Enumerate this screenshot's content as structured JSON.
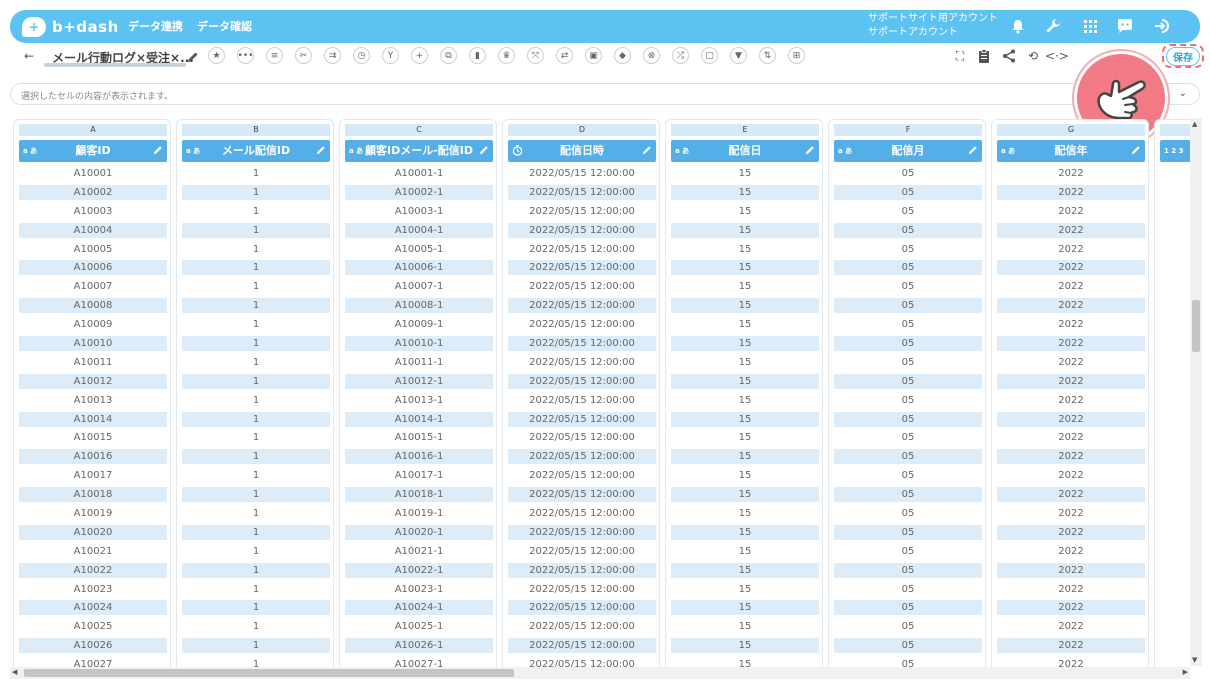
{
  "app": {
    "logo_text": "b+dash"
  },
  "nav": [
    {
      "label": "データ連携"
    },
    {
      "label": "データ確認"
    }
  ],
  "account": {
    "line1": "サポートサイト用アカウント",
    "line2": "サポートアカウント"
  },
  "toolbar": {
    "title": "メール行動ログ×受注×...",
    "save_label": "保存"
  },
  "cellbar": {
    "placeholder": "選択したセルの内容が表示されます。"
  },
  "columns": [
    {
      "letter": "A",
      "name": "顧客ID",
      "type": "a あ"
    },
    {
      "letter": "B",
      "name": "メール配信ID",
      "type": "a あ"
    },
    {
      "letter": "C",
      "name": "顧客IDメール-配信ID",
      "type": "a あ"
    },
    {
      "letter": "D",
      "name": "配信日時",
      "type": "clock"
    },
    {
      "letter": "E",
      "name": "配信日",
      "type": "a あ"
    },
    {
      "letter": "F",
      "name": "配信月",
      "type": "a あ"
    },
    {
      "letter": "G",
      "name": "配信年",
      "type": "a あ"
    },
    {
      "letter": "",
      "name": "",
      "type": "1 2 3"
    }
  ],
  "rows": [
    [
      "A10001",
      "1",
      "A10001-1",
      "2022/05/15 12:00:00",
      "15",
      "05",
      "2022"
    ],
    [
      "A10002",
      "1",
      "A10002-1",
      "2022/05/15 12:00:00",
      "15",
      "05",
      "2022"
    ],
    [
      "A10003",
      "1",
      "A10003-1",
      "2022/05/15 12:00:00",
      "15",
      "05",
      "2022"
    ],
    [
      "A10004",
      "1",
      "A10004-1",
      "2022/05/15 12:00:00",
      "15",
      "05",
      "2022"
    ],
    [
      "A10005",
      "1",
      "A10005-1",
      "2022/05/15 12:00:00",
      "15",
      "05",
      "2022"
    ],
    [
      "A10006",
      "1",
      "A10006-1",
      "2022/05/15 12:00:00",
      "15",
      "05",
      "2022"
    ],
    [
      "A10007",
      "1",
      "A10007-1",
      "2022/05/15 12:00:00",
      "15",
      "05",
      "2022"
    ],
    [
      "A10008",
      "1",
      "A10008-1",
      "2022/05/15 12:00:00",
      "15",
      "05",
      "2022"
    ],
    [
      "A10009",
      "1",
      "A10009-1",
      "2022/05/15 12:00:00",
      "15",
      "05",
      "2022"
    ],
    [
      "A10010",
      "1",
      "A10010-1",
      "2022/05/15 12:00:00",
      "15",
      "05",
      "2022"
    ],
    [
      "A10011",
      "1",
      "A10011-1",
      "2022/05/15 12:00:00",
      "15",
      "05",
      "2022"
    ],
    [
      "A10012",
      "1",
      "A10012-1",
      "2022/05/15 12:00:00",
      "15",
      "05",
      "2022"
    ],
    [
      "A10013",
      "1",
      "A10013-1",
      "2022/05/15 12:00:00",
      "15",
      "05",
      "2022"
    ],
    [
      "A10014",
      "1",
      "A10014-1",
      "2022/05/15 12:00:00",
      "15",
      "05",
      "2022"
    ],
    [
      "A10015",
      "1",
      "A10015-1",
      "2022/05/15 12:00:00",
      "15",
      "05",
      "2022"
    ],
    [
      "A10016",
      "1",
      "A10016-1",
      "2022/05/15 12:00:00",
      "15",
      "05",
      "2022"
    ],
    [
      "A10017",
      "1",
      "A10017-1",
      "2022/05/15 12:00:00",
      "15",
      "05",
      "2022"
    ],
    [
      "A10018",
      "1",
      "A10018-1",
      "2022/05/15 12:00:00",
      "15",
      "05",
      "2022"
    ],
    [
      "A10019",
      "1",
      "A10019-1",
      "2022/05/15 12:00:00",
      "15",
      "05",
      "2022"
    ],
    [
      "A10020",
      "1",
      "A10020-1",
      "2022/05/15 12:00:00",
      "15",
      "05",
      "2022"
    ],
    [
      "A10021",
      "1",
      "A10021-1",
      "2022/05/15 12:00:00",
      "15",
      "05",
      "2022"
    ],
    [
      "A10022",
      "1",
      "A10022-1",
      "2022/05/15 12:00:00",
      "15",
      "05",
      "2022"
    ],
    [
      "A10023",
      "1",
      "A10023-1",
      "2022/05/15 12:00:00",
      "15",
      "05",
      "2022"
    ],
    [
      "A10024",
      "1",
      "A10024-1",
      "2022/05/15 12:00:00",
      "15",
      "05",
      "2022"
    ],
    [
      "A10025",
      "1",
      "A10025-1",
      "2022/05/15 12:00:00",
      "15",
      "05",
      "2022"
    ],
    [
      "A10026",
      "1",
      "A10026-1",
      "2022/05/15 12:00:00",
      "15",
      "05",
      "2022"
    ],
    [
      "A10027",
      "1",
      "A10027-1",
      "2022/05/15 12:00:00",
      "15",
      "05",
      "2022"
    ]
  ],
  "icons": {
    "toolbar": [
      "star-icon",
      "more-icon",
      "list-icon",
      "scissors-icon",
      "merge-icon",
      "timer-icon",
      "branch-icon",
      "plus-icon",
      "copy-icon",
      "trash-icon",
      "crown-icon",
      "expand-icon",
      "swap-icon",
      "lock-icon",
      "box-icon",
      "close-circle-icon",
      "shuffle-icon",
      "text-box-icon",
      "filter-icon",
      "sort-icon",
      "grid-icon"
    ],
    "right": [
      "flow-icon",
      "clipboard-icon",
      "share-icon",
      "refresh-icon",
      "code-icon"
    ]
  },
  "colors": {
    "brand": "#5bc2f2",
    "header": "#54aee8",
    "alt_row": "#dcecf8",
    "accent": "#f27a85"
  }
}
